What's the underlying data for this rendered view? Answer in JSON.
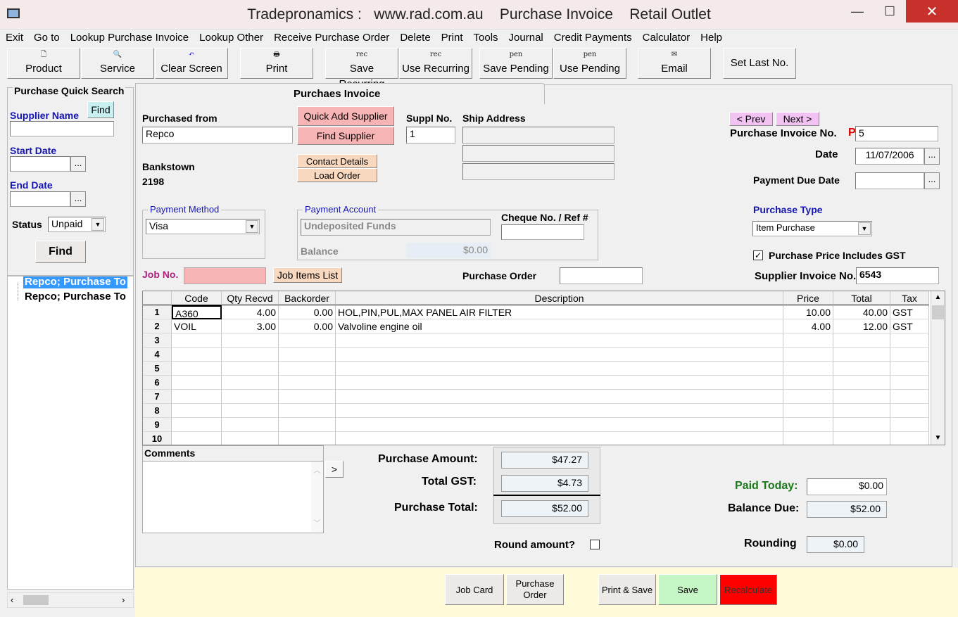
{
  "window": {
    "title": "Tradepronamics :   www.rad.com.au    Purchase Invoice    Retail Outlet",
    "minimize": "—",
    "maximize": "☐",
    "close": "✕"
  },
  "menu": [
    "Exit",
    "Go to",
    "Lookup Purchase Invoice",
    "Lookup Other",
    "Receive Purchase Order",
    "Delete",
    "Print",
    "Tools",
    "Journal",
    "Credit Payments",
    "Calculator",
    "Help"
  ],
  "toolbar": {
    "product": "Product",
    "service": "Service",
    "clear": "Clear Screen",
    "print": "Print",
    "save_recurring": "Save Recurring",
    "use_recurring": "Use Recurring",
    "save_pending": "Save Pending",
    "use_pending": "Use Pending",
    "email": "Email",
    "set_last": "Set Last No.",
    "rec_small": "rec",
    "pen_small": "pen"
  },
  "quick_search": {
    "title": "Purchase Quick Search",
    "supplier_label": "Supplier Name",
    "find_small": "Find",
    "start_label": "Start Date",
    "end_label": "End Date",
    "dots": "...",
    "status_label": "Status",
    "status_value": "Unpaid",
    "find": "Find",
    "results": [
      "Repco; Purchase To",
      "Repco; Purchase To"
    ]
  },
  "invoice": {
    "tab": "Purchaes Invoice",
    "purchased_from_label": "Purchased from",
    "purchased_from": "Repco",
    "quick_add": "Quick Add Supplier",
    "find_supplier": "Find Supplier",
    "contact_details": "Contact Details",
    "load_order": "Load Order",
    "suppl_no_label": "Suppl No.",
    "suppl_no": "1",
    "ship_address_label": "Ship Address",
    "suburb": "Bankstown",
    "postcode": "2198",
    "prev": "< Prev",
    "next": "Next >",
    "invoice_no_label": "Purchase Invoice No.",
    "invoice_prefix": "P",
    "invoice_no": "5",
    "date_label": "Date",
    "date": "11/07/2006",
    "due_label": "Payment Due Date",
    "payment_method_label": "Payment Method",
    "payment_method": "Visa",
    "payment_account_label": "Payment Account",
    "payment_account": "Undeposited Funds",
    "balance_label": "Balance",
    "balance": "$0.00",
    "cheque_label": "Cheque No. / Ref #",
    "purchase_type_label": "Purchase Type",
    "purchase_type": "Item Purchase",
    "gst_includes": "Purchase Price Includes GST",
    "job_no_label": "Job No.",
    "job_items": "Job Items List",
    "purchase_order_label": "Purchase Order",
    "supplier_invoice_label": "Supplier Invoice No.",
    "supplier_invoice": "6543"
  },
  "grid": {
    "headers": [
      "Code",
      "Qty Recvd",
      "Backorder",
      "Description",
      "Price",
      "Total",
      "Tax"
    ],
    "rows": [
      [
        "1",
        "A360",
        "4.00",
        "0.00",
        "HOL,PIN,PUL,MAX PANEL AIR FILTER",
        "10.00",
        "40.00",
        "GST"
      ],
      [
        "2",
        "VOIL",
        "3.00",
        "0.00",
        "Valvoline engine oil",
        "4.00",
        "12.00",
        "GST"
      ],
      [
        "3",
        "",
        "",
        "",
        "",
        "",
        "",
        ""
      ],
      [
        "4",
        "",
        "",
        "",
        "",
        "",
        "",
        ""
      ],
      [
        "5",
        "",
        "",
        "",
        "",
        "",
        "",
        ""
      ],
      [
        "6",
        "",
        "",
        "",
        "",
        "",
        "",
        ""
      ],
      [
        "7",
        "",
        "",
        "",
        "",
        "",
        "",
        ""
      ],
      [
        "8",
        "",
        "",
        "",
        "",
        "",
        "",
        ""
      ],
      [
        "9",
        "",
        "",
        "",
        "",
        "",
        "",
        ""
      ],
      [
        "10",
        "",
        "",
        "",
        "",
        "",
        "",
        ""
      ]
    ]
  },
  "totals": {
    "comments_label": "Comments",
    "expand": ">",
    "purchase_amount_label": "Purchase Amount:",
    "purchase_amount": "$47.27",
    "total_gst_label": "Total GST:",
    "total_gst": "$4.73",
    "purchase_total_label": "Purchase Total:",
    "purchase_total": "$52.00",
    "round_label": "Round amount?",
    "paid_today_label": "Paid Today:",
    "paid_today": "$0.00",
    "balance_due_label": "Balance Due:",
    "balance_due": "$52.00",
    "rounding_label": "Rounding",
    "rounding": "$0.00"
  },
  "bottom": {
    "job_card": "Job Card",
    "purchase_order": "Purchase\nOrder",
    "print_save": "Print & Save",
    "save": "Save",
    "recalculate": "Recalculate"
  },
  "colors": {
    "pink": "#f7b4b4",
    "peach": "#f8d8bf",
    "save_green": "#c6f5c6",
    "recalc_red": "#ff0000",
    "label_blue": "#1515b5",
    "paid_green": "#1a7a1a",
    "bottom_yellow": "#fffbd8"
  }
}
